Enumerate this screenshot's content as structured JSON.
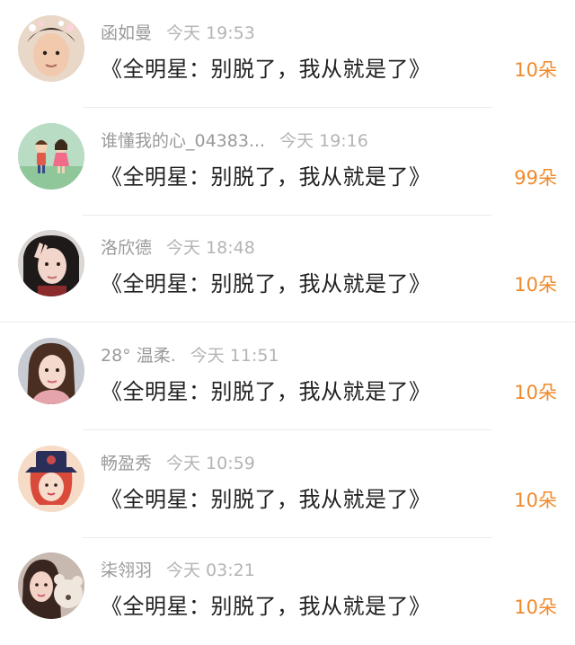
{
  "rows": [
    {
      "name": "函如曼",
      "time": "今天 19:53",
      "title": "《全明星：别脱了，我从就是了》",
      "gift": "10朵",
      "avatar": "avatar-boy-hat"
    },
    {
      "name": "谁懂我的心_04383...",
      "time": "今天 19:16",
      "title": "《全明星：别脱了，我从就是了》",
      "gift": "99朵",
      "avatar": "avatar-cartoon-couple"
    },
    {
      "name": "洛欣德",
      "time": "今天 18:48",
      "title": "《全明星：别脱了，我从就是了》",
      "gift": "10朵",
      "avatar": "avatar-girl-peace"
    },
    {
      "name": "28° 温柔.",
      "time": "今天 11:51",
      "title": "《全明星：别脱了，我从就是了》",
      "gift": "10朵",
      "avatar": "avatar-woman-longhair"
    },
    {
      "name": "畅盈秀",
      "time": "今天 10:59",
      "title": "《全明星：别脱了，我从就是了》",
      "gift": "10朵",
      "avatar": "avatar-cartoon-hat"
    },
    {
      "name": "柒翎羽",
      "time": "今天 03:21",
      "title": "《全明星：别脱了，我从就是了》",
      "gift": "10朵",
      "avatar": "avatar-girl-teddy"
    }
  ],
  "colors": {
    "gift": "#f08a2a",
    "meta": "#a8a8a8",
    "title": "#222222"
  }
}
